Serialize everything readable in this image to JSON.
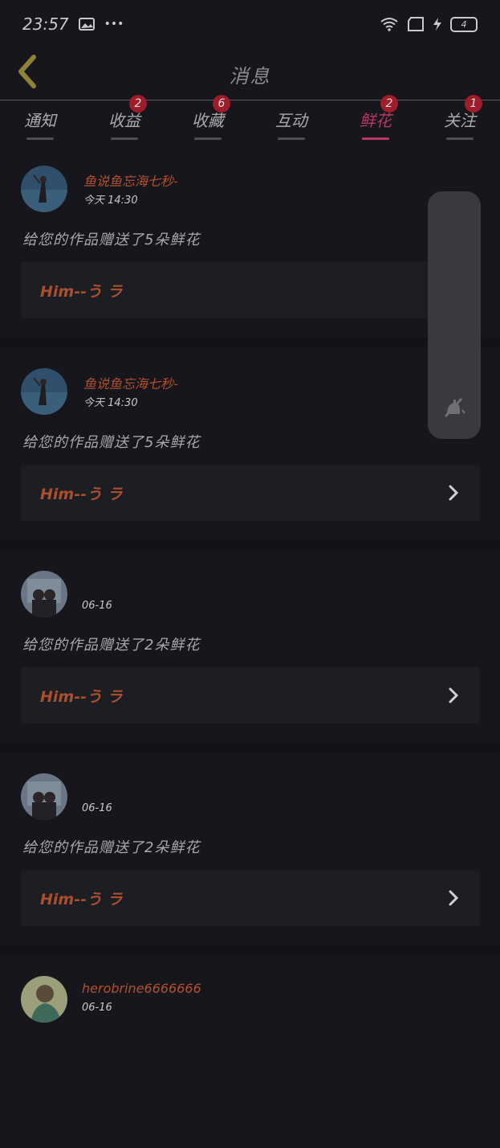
{
  "status": {
    "time": "23:57",
    "dots": "•••",
    "battery": "4",
    "icons": [
      "image-icon",
      "wifi-icon",
      "sim-card-icon",
      "charging-icon",
      "battery-icon"
    ]
  },
  "header": {
    "title": "消息",
    "back_icon": "chevron-left-icon"
  },
  "tabs": [
    {
      "label": "通知",
      "badge": ""
    },
    {
      "label": "收益",
      "badge": "2"
    },
    {
      "label": "收藏",
      "badge": "6"
    },
    {
      "label": "互动",
      "badge": ""
    },
    {
      "label": "鲜花",
      "badge": "2"
    },
    {
      "label": "关注",
      "badge": "1"
    }
  ],
  "active_tab": "鲜花",
  "messages": [
    {
      "name": "鱼说鱼忘海七秒-",
      "time": "今天 14:30",
      "text": "给您的作品赠送了5朵鲜花",
      "work": "Him--う ラ"
    },
    {
      "name": "鱼说鱼忘海七秒-",
      "time": "今天 14:30",
      "text": "给您的作品赠送了5朵鲜花",
      "work": "Him--う ラ"
    },
    {
      "name": "",
      "time": "06-16",
      "text": "给您的作品赠送了2朵鲜花",
      "work": "Him--う ラ"
    },
    {
      "name": "",
      "time": "06-16",
      "text": "给您的作品赠送了2朵鲜花",
      "work": "Him--う ラ"
    },
    {
      "name": "herobrine6666666",
      "time": "06-16",
      "text": "",
      "work": ""
    }
  ],
  "side_panel": {
    "icon": "mute-icon"
  },
  "colors": {
    "background": "#16161c",
    "accent": "#b83a63",
    "badge": "#9e1d2a",
    "name": "#b2512f",
    "card": "#1d1d24"
  }
}
